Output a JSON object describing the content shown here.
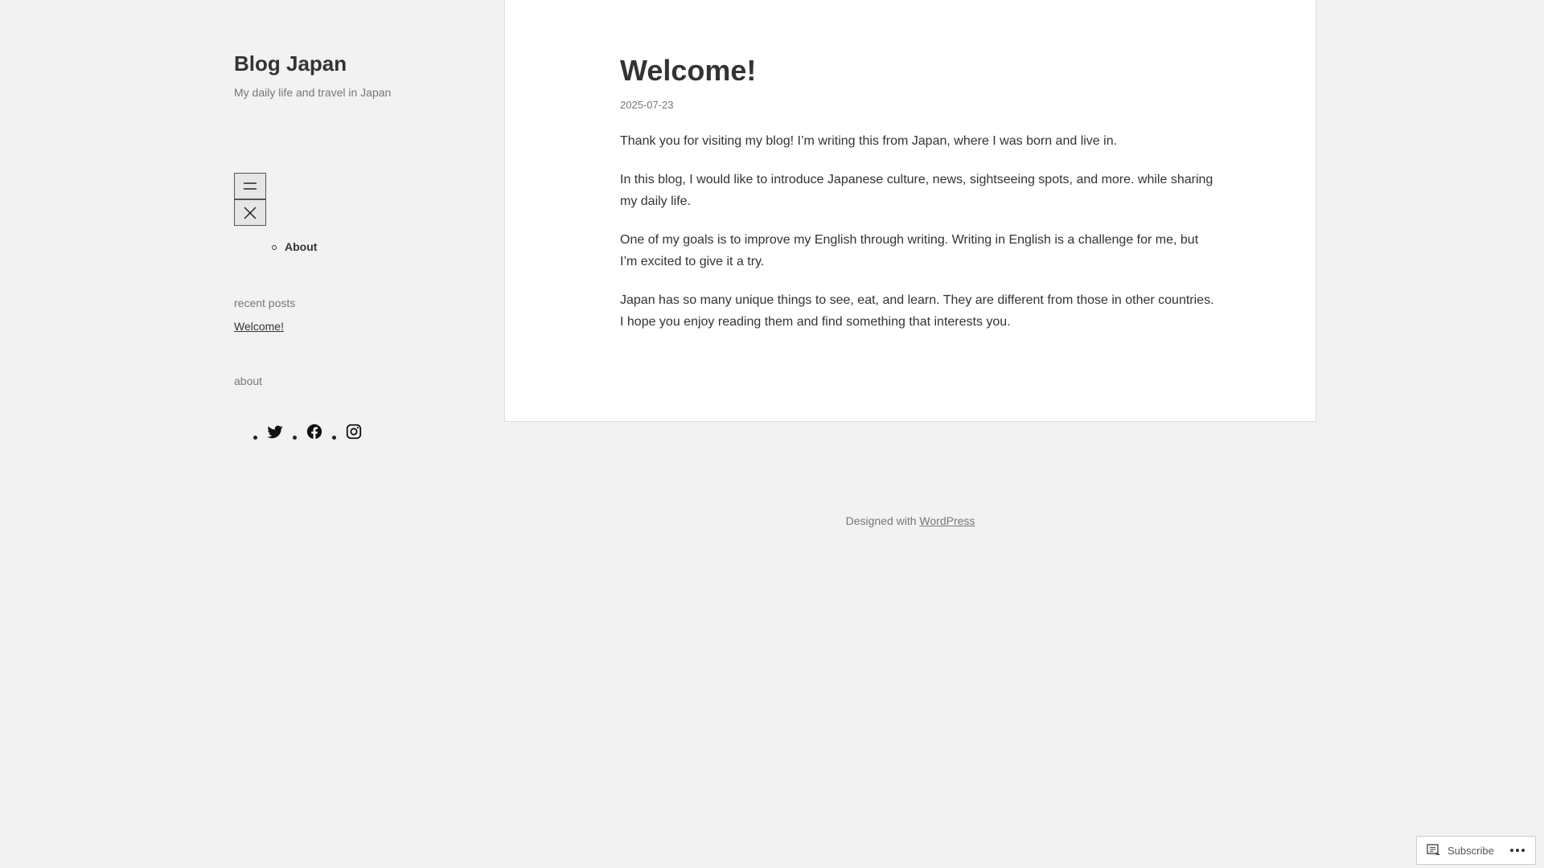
{
  "site": {
    "title": "Blog Japan",
    "description": "My daily life and travel in Japan"
  },
  "nav": {
    "open_icon": "hamburger-menu-icon",
    "close_icon": "close-icon",
    "items": [
      {
        "label": "About"
      }
    ]
  },
  "widgets": {
    "recent_posts": {
      "title": "recent posts",
      "items": [
        {
          "label": "Welcome!"
        }
      ]
    },
    "about": {
      "title": "about"
    },
    "social_icons": [
      "twitter-icon",
      "facebook-icon",
      "instagram-icon"
    ]
  },
  "post": {
    "title": "Welcome!",
    "date": "2025-07-23",
    "paragraphs": [
      "Thank you for visiting my blog! I’m writing this from Japan, where I was born and live in.",
      "In this blog, I would like to introduce Japanese culture, news, sightseeing spots, and more. while sharing my daily life.",
      "One of my goals is to improve my English through writing. Writing in English is a challenge for me, but I’m excited to give it a try.",
      "Japan has so many unique things to see, eat, and learn. They are different from those in other countries. I hope you enjoy reading them and find something that interests you."
    ]
  },
  "footer": {
    "prefix": "Designed with",
    "link": "WordPress"
  },
  "subscribe": {
    "label": "Subscribe",
    "icon": "reader-icon",
    "more_icon": "ellipsis-icon"
  }
}
